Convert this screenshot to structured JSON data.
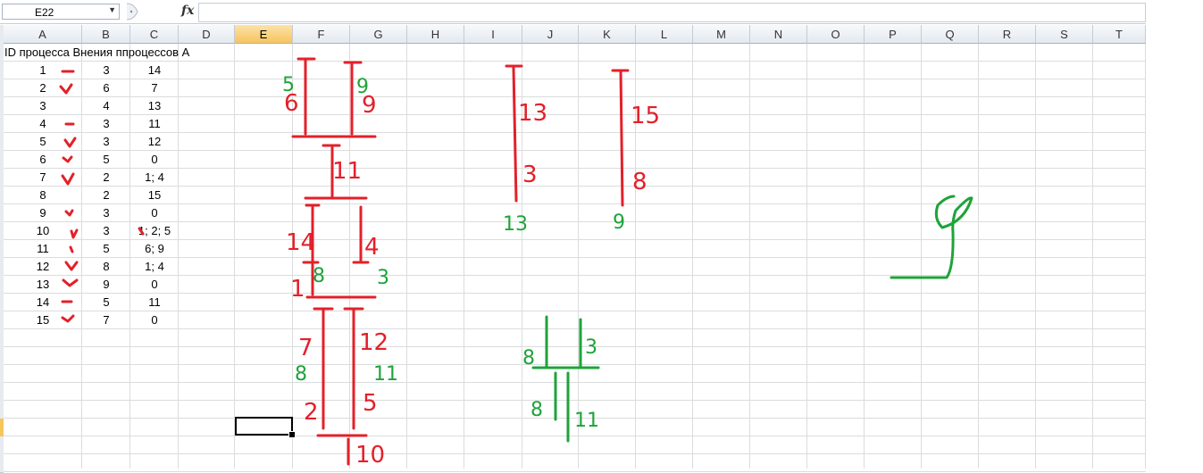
{
  "formula_bar": {
    "name_box": "E22",
    "fx_label": "fx",
    "formula_value": ""
  },
  "columns": [
    "A",
    "B",
    "C",
    "D",
    "E",
    "F",
    "G",
    "H",
    "I",
    "J",
    "K",
    "L",
    "M",
    "N",
    "O",
    "P",
    "Q",
    "R",
    "S",
    "T"
  ],
  "active_column": "E",
  "header_row_text": "ID процесса Внения ппроцессов А",
  "rows": [
    {
      "a": "1",
      "b": "3",
      "c": "14"
    },
    {
      "a": "2",
      "b": "6",
      "c": "7"
    },
    {
      "a": "3",
      "b": "4",
      "c": "13"
    },
    {
      "a": "4",
      "b": "3",
      "c": "11"
    },
    {
      "a": "5",
      "b": "3",
      "c": "12"
    },
    {
      "a": "6",
      "b": "5",
      "c": "0"
    },
    {
      "a": "7",
      "b": "2",
      "c": "1; 4"
    },
    {
      "a": "8",
      "b": "2",
      "c": "15"
    },
    {
      "a": "9",
      "b": "3",
      "c": "0"
    },
    {
      "a": "10",
      "b": "3",
      "c": "1; 2; 5"
    },
    {
      "a": "11",
      "b": "5",
      "c": "6; 9"
    },
    {
      "a": "12",
      "b": "8",
      "c": "1; 4"
    },
    {
      "a": "13",
      "b": "9",
      "c": "0"
    },
    {
      "a": "14",
      "b": "5",
      "c": "11"
    },
    {
      "a": "15",
      "b": "7",
      "c": "0"
    }
  ],
  "ink_colors": {
    "red": "#e3202a",
    "green": "#1ea33a"
  },
  "annotations_red": [
    "5",
    "6",
    "9",
    "11",
    "14",
    "4",
    "1",
    "7",
    "12",
    "2",
    "5",
    "10",
    "13",
    "3",
    "15",
    "8",
    "8",
    "3"
  ],
  "annotations_green": [
    "5",
    "9",
    "8",
    "3",
    "8",
    "11",
    "13",
    "9",
    "8",
    "8",
    "3",
    "11",
    "9"
  ]
}
